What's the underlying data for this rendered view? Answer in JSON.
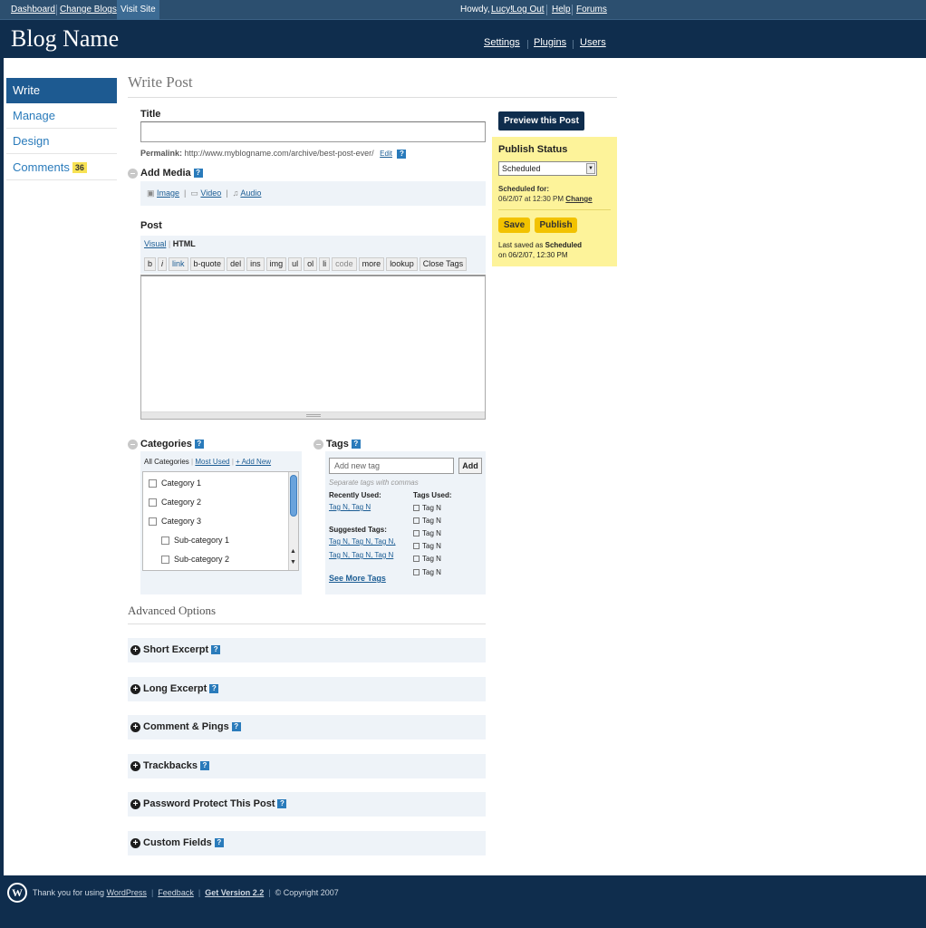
{
  "topbar": {
    "dashboard": "Dashboard",
    "change_blogs": "Change Blogs",
    "visit_site": "Visit Site",
    "howdy": "Howdy,",
    "user": "Lucy!",
    "logout": "Log Out",
    "help": "Help",
    "forums": "Forums"
  },
  "header": {
    "blog_name": "Blog Name",
    "settings": "Settings",
    "plugins": "Plugins",
    "users": "Users"
  },
  "sidebar": {
    "items": [
      {
        "label": "Write"
      },
      {
        "label": "Manage"
      },
      {
        "label": "Design"
      },
      {
        "label": "Comments",
        "count": "36"
      }
    ]
  },
  "page": {
    "title": "Write Post"
  },
  "post": {
    "title_label": "Title",
    "title_value": "",
    "permalink_label": "Permalink:",
    "permalink_url": "http://www.myblogname.com/archive/best-post-ever/",
    "edit": "Edit",
    "add_media": "Add Media",
    "media_image": "Image",
    "media_video": "Video",
    "media_audio": "Audio",
    "post_label": "Post",
    "tab_visual": "Visual",
    "tab_html": "HTML",
    "quicktags": [
      "b",
      "i",
      "link",
      "b-quote",
      "del",
      "ins",
      "img",
      "ul",
      "ol",
      "li",
      "code",
      "more",
      "lookup",
      "Close Tags"
    ]
  },
  "categories": {
    "label": "Categories",
    "tab_all": "All Categories",
    "tab_most": "Most Used",
    "tab_add": "+ Add New",
    "items": [
      "Category 1",
      "Category 2",
      "Category 3",
      "Sub-category 1",
      "Sub-category 2"
    ]
  },
  "tags": {
    "label": "Tags",
    "placeholder": "Add new tag",
    "add": "Add",
    "hint": "Separate tags with commas",
    "recent_label": "Recently Used:",
    "recent": "Tag N, Tag N",
    "suggested_label": "Suggested Tags:",
    "suggested_1": "Tag N, Tag N, Tag N,",
    "suggested_2": "Tag N, Tag N, Tag N",
    "see_more": "See More Tags",
    "used_label": "Tags Used:",
    "used": [
      "Tag N",
      "Tag N",
      "Tag N",
      "Tag N",
      "Tag N",
      "Tag N"
    ]
  },
  "advanced": {
    "label": "Advanced Options",
    "sections": [
      "Short Excerpt",
      "Long Excerpt",
      "Comment & Pings",
      "Trackbacks",
      "Password Protect This Post",
      "Custom Fields"
    ]
  },
  "publish": {
    "preview": "Preview this Post",
    "status_label": "Publish Status",
    "status_value": "Scheduled",
    "scheduled_for": "Scheduled for:",
    "scheduled_date": "06/2/07 at 12:30 PM",
    "change": "Change",
    "save": "Save",
    "publish": "Publish",
    "last_saved_prefix": "Last saved as",
    "last_saved_status": "Scheduled",
    "last_saved_date": "on 06/2/07, 12:30 PM"
  },
  "footer": {
    "thanks_prefix": "Thank you for using",
    "wordpress": "WordPress",
    "feedback": "Feedback",
    "get_version": "Get Version 2.2",
    "copyright": "© Copyright 2007"
  },
  "colors": {
    "header_bg": "#0f2d4d",
    "nav_active": "#1d5a91",
    "publish_box": "#fdf39a",
    "button_yellow": "#f2c200"
  }
}
